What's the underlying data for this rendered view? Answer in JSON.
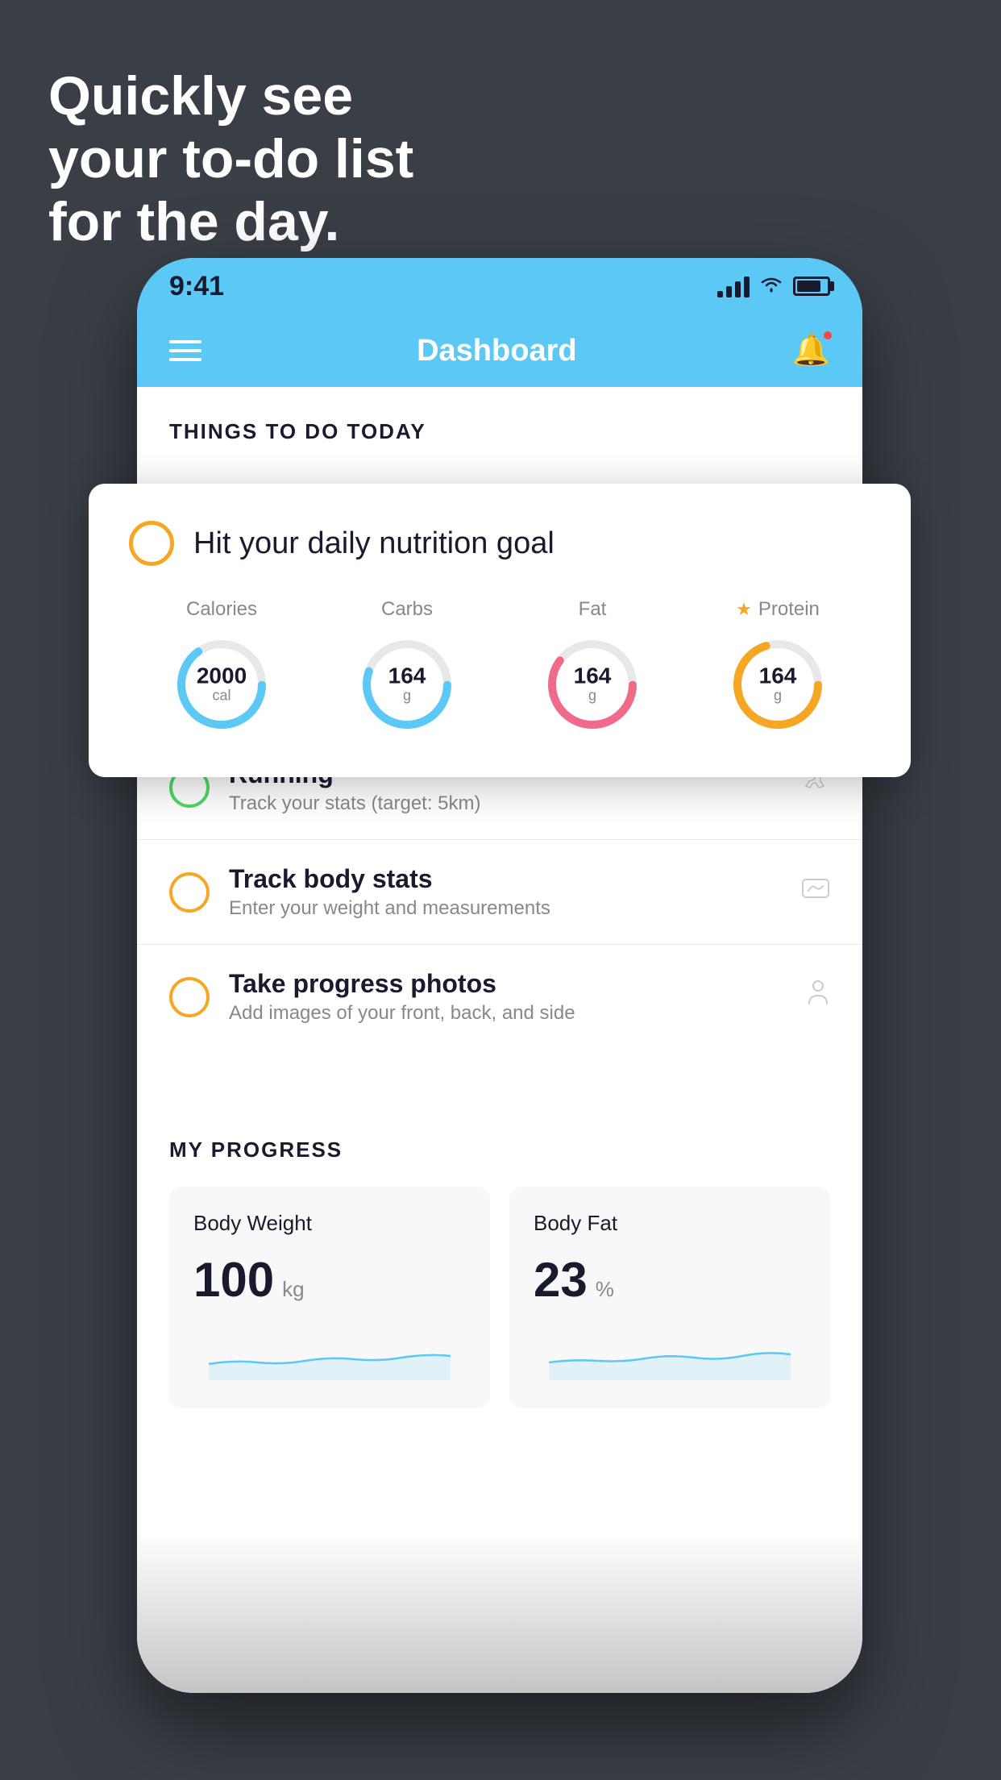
{
  "background": {
    "color": "#3a3f47"
  },
  "headline": {
    "line1": "Quickly see",
    "line2": "your to-do list",
    "line3": "for the day."
  },
  "phone": {
    "status_bar": {
      "time": "9:41"
    },
    "nav": {
      "title": "Dashboard"
    },
    "sections": {
      "todo_header": "THINGS TO DO TODAY",
      "progress_header": "MY PROGRESS"
    },
    "nutrition_card": {
      "title": "Hit your daily nutrition goal",
      "stats": [
        {
          "label": "Calories",
          "value": "2000",
          "unit": "cal",
          "color": "#5bc8f5",
          "percent": 65
        },
        {
          "label": "Carbs",
          "value": "164",
          "unit": "g",
          "color": "#5bc8f5",
          "percent": 55
        },
        {
          "label": "Fat",
          "value": "164",
          "unit": "g",
          "color": "#f06b8a",
          "percent": 60
        },
        {
          "label": "Protein",
          "value": "164",
          "unit": "g",
          "color": "#f5a623",
          "percent": 70,
          "starred": true
        }
      ]
    },
    "todo_items": [
      {
        "title": "Running",
        "subtitle": "Track your stats (target: 5km)",
        "circle_color": "green",
        "icon": "shoe"
      },
      {
        "title": "Track body stats",
        "subtitle": "Enter your weight and measurements",
        "circle_color": "yellow",
        "icon": "scale"
      },
      {
        "title": "Take progress photos",
        "subtitle": "Add images of your front, back, and side",
        "circle_color": "yellow",
        "icon": "person"
      }
    ],
    "progress_cards": [
      {
        "title": "Body Weight",
        "value": "100",
        "unit": "kg"
      },
      {
        "title": "Body Fat",
        "value": "23",
        "unit": "%"
      }
    ]
  }
}
